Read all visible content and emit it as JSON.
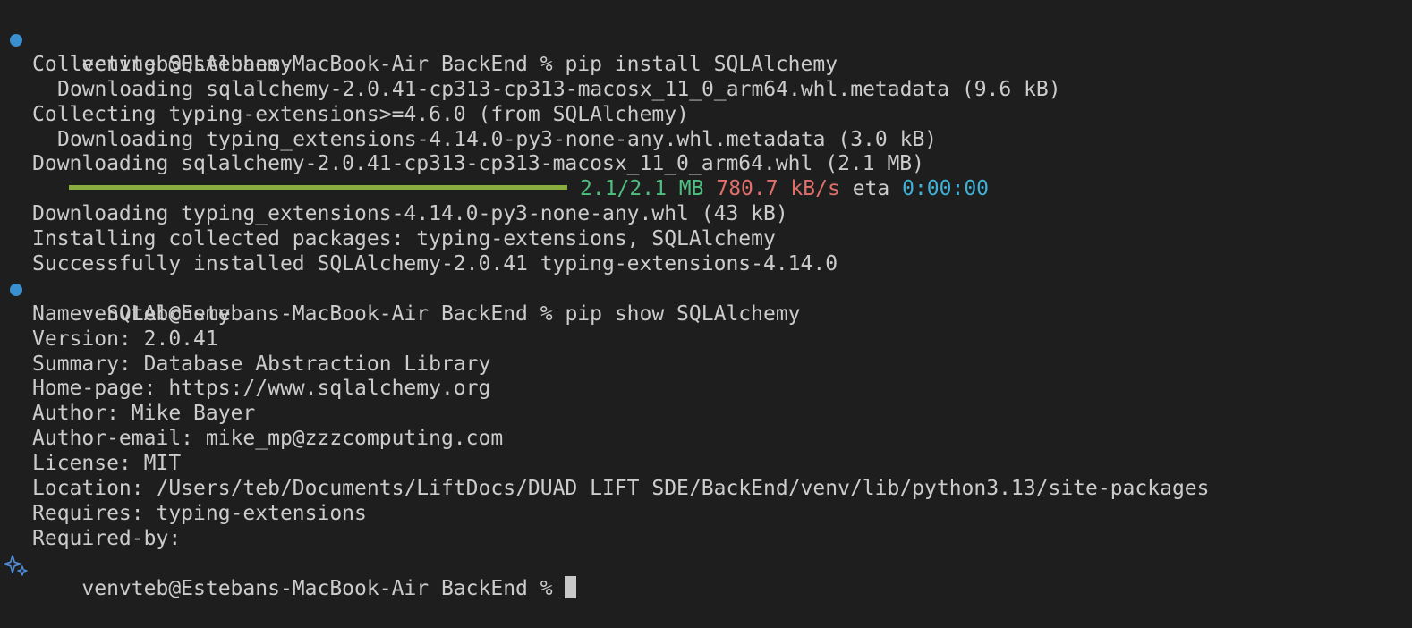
{
  "colors": {
    "background": "#1e1e1e",
    "text": "#cccccc",
    "prompt_dot": "#3a8fcf",
    "progress_bar": "#8bad3f",
    "size_text": "#4fbf7f",
    "speed_text": "#e0706b",
    "eta_text": "#3fb0d6"
  },
  "icons": {
    "prompt_marker": "circle-dot-icon",
    "last_prompt_marker": "sparkle-icon"
  },
  "prompt": "venvteb@Estebans-MacBook-Air BackEnd % ",
  "commands": {
    "install": "pip install SQLAlchemy",
    "show": "pip show SQLAlchemy"
  },
  "install_output": {
    "collecting_sqlalchemy": "Collecting SQLAlchemy",
    "downloading_sqlalchemy_metadata": "Downloading sqlalchemy-2.0.41-cp313-cp313-macosx_11_0_arm64.whl.metadata (9.6 kB)",
    "collecting_typing": "Collecting typing-extensions>=4.6.0 (from SQLAlchemy)",
    "downloading_typing_metadata": "Downloading typing_extensions-4.14.0-py3-none-any.whl.metadata (3.0 kB)",
    "downloading_sqlalchemy_whl": "Downloading sqlalchemy-2.0.41-cp313-cp313-macosx_11_0_arm64.whl (2.1 MB)",
    "progress": {
      "fraction": 1.0,
      "size": "2.1/2.1 MB",
      "speed": "780.7 kB/s",
      "eta_label": "eta",
      "eta": "0:00:00"
    },
    "downloading_typing_whl": "Downloading typing_extensions-4.14.0-py3-none-any.whl (43 kB)",
    "installing": "Installing collected packages: typing-extensions, SQLAlchemy",
    "success": "Successfully installed SQLAlchemy-2.0.41 typing-extensions-4.14.0"
  },
  "show_output": [
    "Name: SQLAlchemy",
    "Version: 2.0.41",
    "Summary: Database Abstraction Library",
    "Home-page: https://www.sqlalchemy.org",
    "Author: Mike Bayer",
    "Author-email: mike_mp@zzzcomputing.com",
    "License: MIT",
    "Location: /Users/teb/Documents/LiftDocs/DUAD LIFT SDE/BackEnd/venv/lib/python3.13/site-packages",
    "Requires: typing-extensions",
    "Required-by:"
  ]
}
